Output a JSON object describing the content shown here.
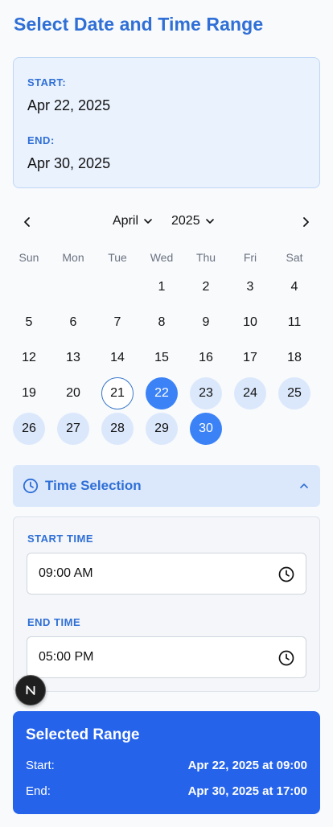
{
  "page_title": "Select Date and Time Range",
  "summary": {
    "start_label": "START:",
    "start_value": "Apr 22, 2025",
    "end_label": "END:",
    "end_value": "Apr 30, 2025"
  },
  "calendar": {
    "month": "April",
    "year": "2025",
    "weekdays": [
      "Sun",
      "Mon",
      "Tue",
      "Wed",
      "Thu",
      "Fri",
      "Sat"
    ],
    "first_weekday_index": 3,
    "days_in_month": 30,
    "today": 21,
    "range_start": 22,
    "range_end": 30
  },
  "time_selection": {
    "header": "Time Selection",
    "start_label": "START TIME",
    "start_value": "09:00 AM",
    "end_label": "END TIME",
    "end_value": "05:00 PM"
  },
  "fab_label": "N",
  "result": {
    "title": "Selected Range",
    "start_key": "Start:",
    "start_value": "Apr 22, 2025 at 09:00",
    "end_key": "End:",
    "end_value": "Apr 30, 2025 at 17:00"
  },
  "colors": {
    "accent": "#2f6fd6",
    "selected": "#3b82f6",
    "range": "#dbe8fc",
    "result_bg": "#2563eb"
  }
}
